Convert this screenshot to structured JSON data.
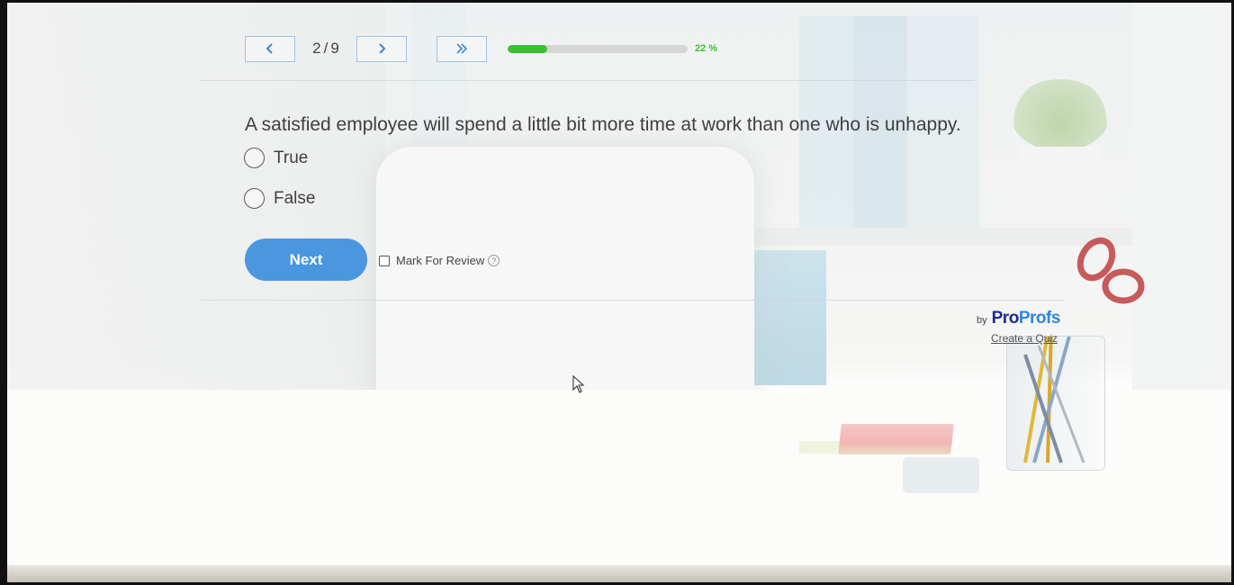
{
  "nav": {
    "prev_icon": "chevron-left-icon",
    "next_icon": "chevron-right-icon",
    "skip_icon": "double-chevron-right-icon",
    "current": "2",
    "separator": "/",
    "total": "9"
  },
  "progress": {
    "fraction": 0.22,
    "label": "22 %",
    "color": "#3cbf36"
  },
  "question": {
    "text": "A satisfied employee will spend a little bit more time at work than one who is unhappy.",
    "options": [
      {
        "label": "True",
        "selected": false
      },
      {
        "label": "False",
        "selected": false
      }
    ]
  },
  "actions": {
    "next_label": "Next",
    "next_color": "#4a97e0",
    "mark_review_label": "Mark For Review",
    "mark_review_checked": false,
    "help_glyph": "?"
  },
  "branding": {
    "by": "by",
    "logo_part1": "Pro",
    "logo_part2": "Profs",
    "create_link": "Create a Quiz"
  }
}
